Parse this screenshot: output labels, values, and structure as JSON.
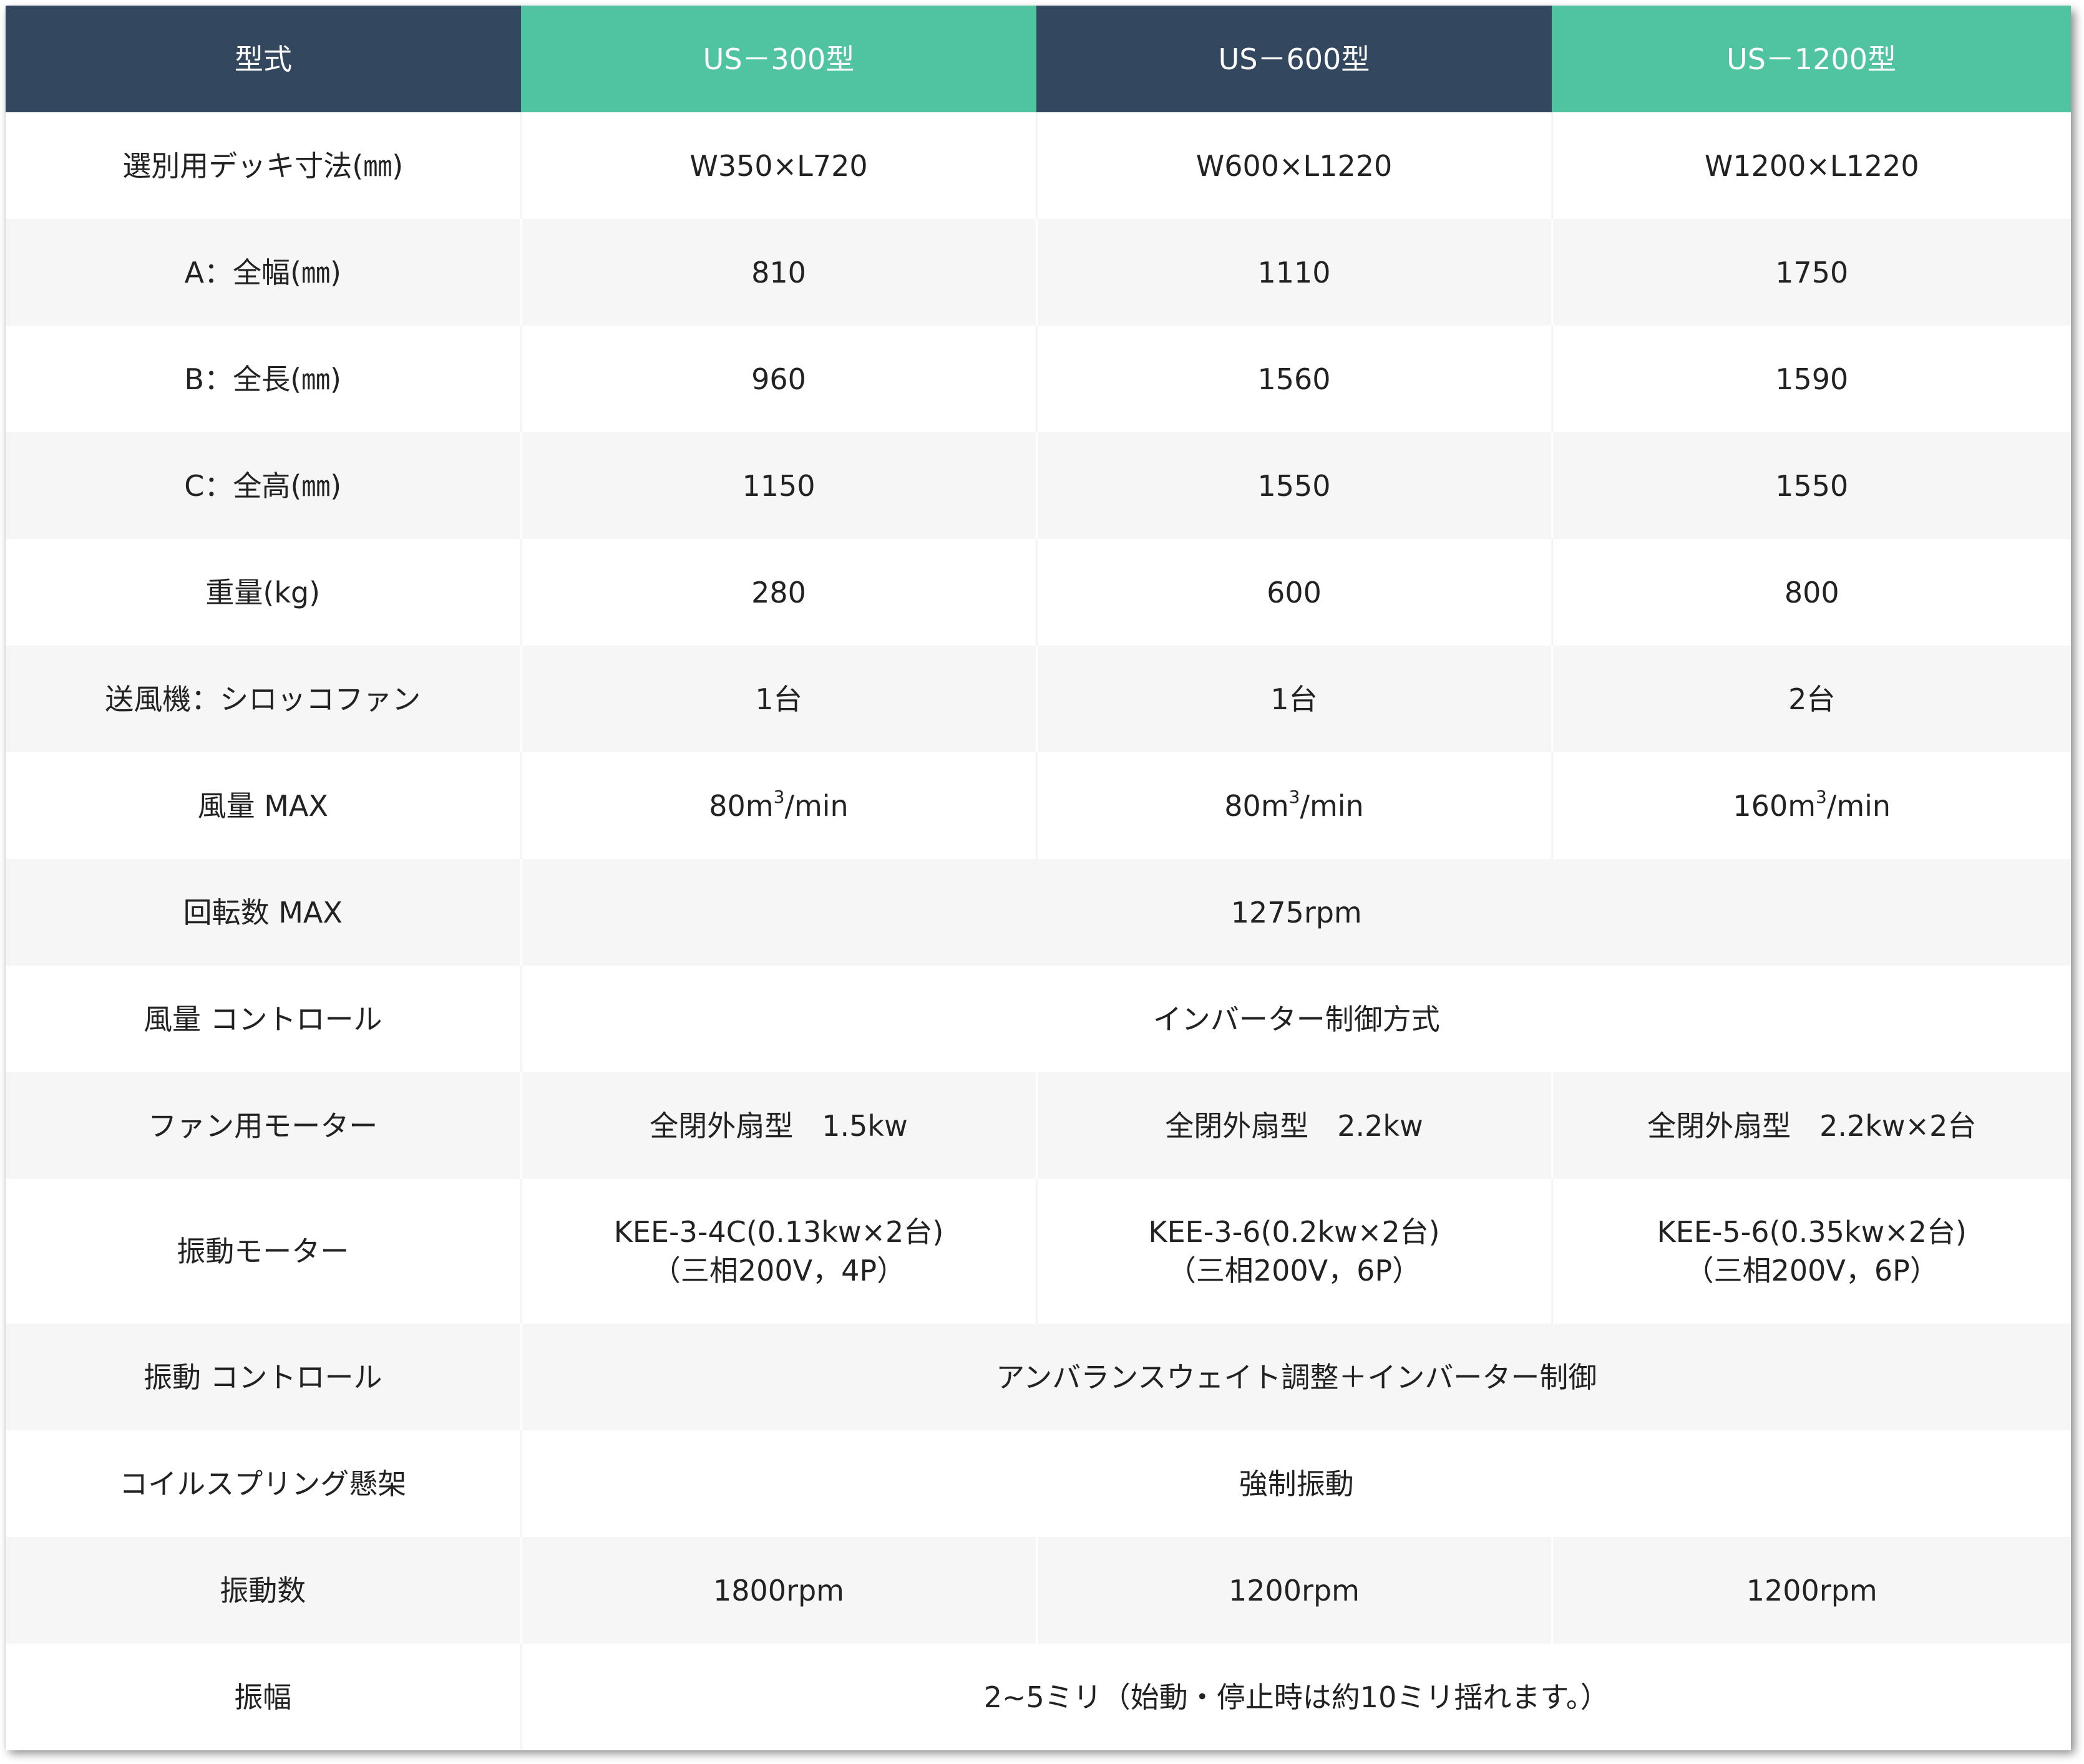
{
  "header": {
    "label": "型式",
    "models": [
      "US－300型",
      "US－600型",
      "US－1200型"
    ]
  },
  "rows": [
    {
      "label": "選別用デッキ寸法(㎜)",
      "values": [
        "W350×L720",
        "W600×L1220",
        "W1200×L1220"
      ]
    },
    {
      "label": "A：全幅(㎜)",
      "values": [
        "810",
        "1110",
        "1750"
      ]
    },
    {
      "label": "B：全長(㎜)",
      "values": [
        "960",
        "1560",
        "1590"
      ]
    },
    {
      "label": "C：全高(㎜)",
      "values": [
        "1150",
        "1550",
        "1550"
      ]
    },
    {
      "label": "重量(kg)",
      "values": [
        "280",
        "600",
        "800"
      ]
    },
    {
      "label": "送風機：シロッコファン",
      "values": [
        "1台",
        "1台",
        "2台"
      ]
    },
    {
      "label": "風量 MAX",
      "airflow": [
        {
          "number": "80m",
          "sup": "3",
          "unit": "/min"
        },
        {
          "number": "80m",
          "sup": "3",
          "unit": "/min"
        },
        {
          "number": "160m",
          "sup": "3",
          "unit": "/min"
        }
      ]
    },
    {
      "label": "回転数 MAX",
      "value": "1275rpm"
    },
    {
      "label": "風量 コントロール",
      "value": "インバーター制御方式"
    },
    {
      "label": "ファン用モーター",
      "values": [
        "全閉外扇型　1.5kw",
        "全閉外扇型　2.2kw",
        "全閉外扇型　2.2kw×2台"
      ]
    },
    {
      "label": "振動モーター",
      "values": [
        {
          "line1": "KEE-3-4C(0.13kw×2台)",
          "line2": "（三相200V，4P）"
        },
        {
          "line1": "KEE-3-6(0.2kw×2台)",
          "line2": "（三相200V，6P）"
        },
        {
          "line1": "KEE-5-6(0.35kw×2台)",
          "line2": "（三相200V，6P）"
        }
      ]
    },
    {
      "label": "振動 コントロール",
      "value": "アンバランスウェイト調整＋インバーター制御"
    },
    {
      "label": "コイルスプリング懸架",
      "value": "強制振動"
    },
    {
      "label": "振動数",
      "values": [
        "1800rpm",
        "1200rpm",
        "1200rpm"
      ]
    },
    {
      "label": "振幅",
      "value": "2~5ミリ（始動・停止時は約10ミリ揺れます。）"
    }
  ],
  "colors": {
    "header_navy": "#33475f",
    "header_teal": "#50c4a1",
    "row_stripe": "#f6f6f6",
    "text": "#222222"
  }
}
